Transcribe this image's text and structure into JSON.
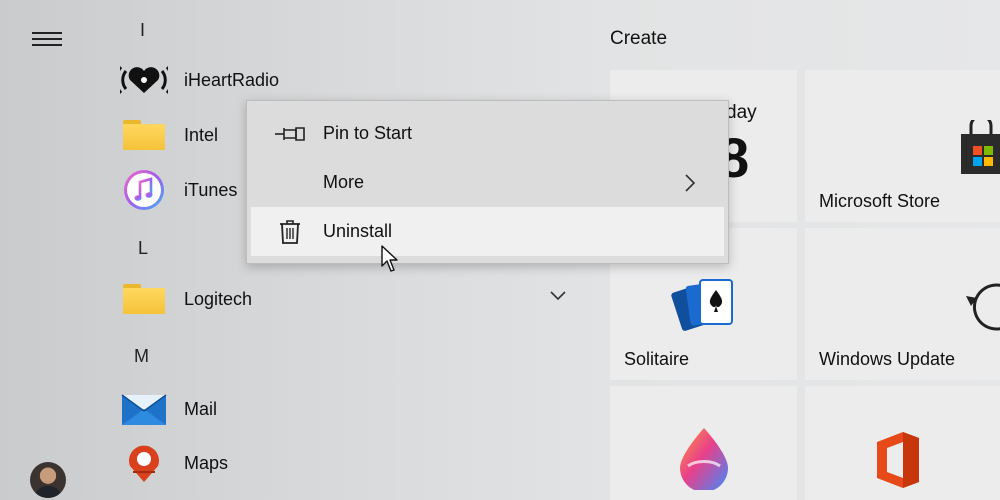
{
  "start_menu": {
    "tiles_header": "Create",
    "app_list": [
      {
        "type": "letter",
        "text": "I"
      },
      {
        "type": "app",
        "label": "iHeartRadio",
        "icon": "iheartradio-icon"
      },
      {
        "type": "app",
        "label": "Intel",
        "icon": "folder-icon"
      },
      {
        "type": "app",
        "label": "iTunes",
        "icon": "itunes-icon"
      },
      {
        "type": "letter",
        "text": "L"
      },
      {
        "type": "app",
        "label": "Logitech",
        "icon": "folder-icon",
        "expandable": true
      },
      {
        "type": "letter",
        "text": "M"
      },
      {
        "type": "app",
        "label": "Mail",
        "icon": "mail-icon"
      },
      {
        "type": "app",
        "label": "Maps",
        "icon": "maps-icon"
      }
    ],
    "tiles": [
      {
        "label": "",
        "partial_text": "day",
        "partial_digit": "8",
        "icon": "calendar-icon"
      },
      {
        "label": "Microsoft Store",
        "icon": "microsoft-store-icon"
      },
      {
        "label": "Solitaire",
        "icon": "solitaire-icon"
      },
      {
        "label": "Windows Update",
        "icon": "windows-update-icon"
      },
      {
        "label": "",
        "icon": "paint-icon"
      },
      {
        "label": "",
        "icon": "office-icon"
      }
    ]
  },
  "context_menu": {
    "items": [
      {
        "label": "Pin to Start",
        "icon": "pin-icon"
      },
      {
        "label": "More",
        "icon": "",
        "has_submenu": true
      },
      {
        "label": "Uninstall",
        "icon": "trash-icon",
        "highlighted": true
      }
    ]
  },
  "colors": {
    "menu_bg": "#dcdcdc",
    "menu_hover": "#f0f0f0",
    "tile_bg": "#ececed",
    "folder_yellow": "#f5c33a"
  }
}
